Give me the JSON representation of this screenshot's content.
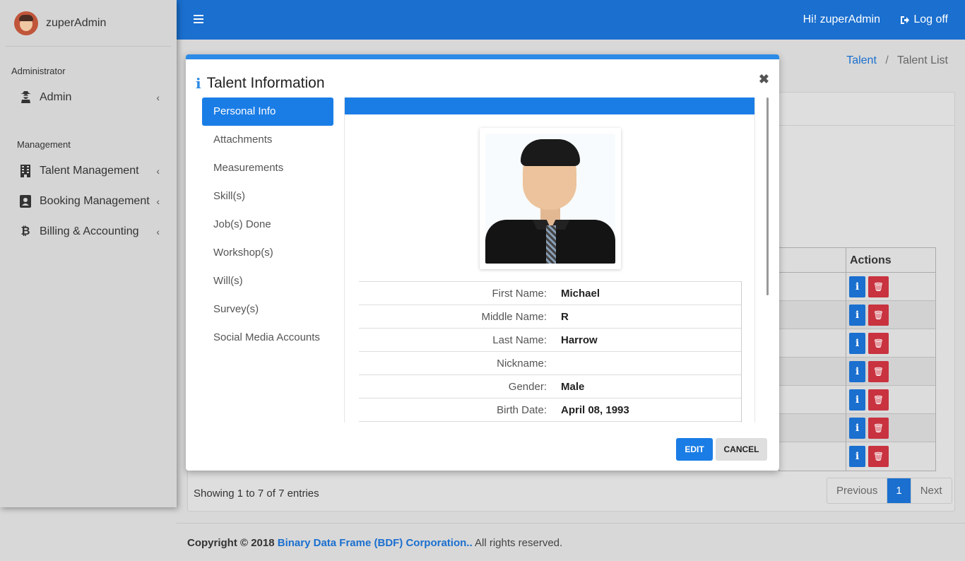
{
  "sidebar": {
    "user_name": "zuperAdmin",
    "section1": "Administrator",
    "admin_item": "Admin",
    "section2": "Management",
    "items": [
      {
        "label": "Talent Management",
        "icon": "building-icon"
      },
      {
        "label": "Booking Management",
        "icon": "contact-book-icon"
      },
      {
        "label": "Billing & Accounting",
        "icon": "bitcoin-icon"
      }
    ]
  },
  "topbar": {
    "greeting": "Hi! zuperAdmin",
    "logoff": "Log off"
  },
  "breadcrumb": {
    "link": "Talent",
    "current": "Talent List"
  },
  "table": {
    "actions_header": "Actions",
    "row_count": 7
  },
  "entries_text": "Showing 1 to 7 of 7 entries",
  "pager": {
    "previous": "Previous",
    "page": "1",
    "next": "Next"
  },
  "footer": {
    "copyright": "Copyright © 2018",
    "company": "Binary Data Frame (BDF) Corporation..",
    "rights": "All rights reserved."
  },
  "modal": {
    "title": "Talent Information",
    "tabs": [
      "Personal Info",
      "Attachments",
      "Measurements",
      "Skill(s)",
      "Job(s) Done",
      "Workshop(s)",
      "Will(s)",
      "Survey(s)",
      "Social Media Accounts"
    ],
    "fields": [
      {
        "label": "First Name:",
        "value": "Michael"
      },
      {
        "label": "Middle Name:",
        "value": "R"
      },
      {
        "label": "Last Name:",
        "value": "Harrow"
      },
      {
        "label": "Nickname:",
        "value": ""
      },
      {
        "label": "Gender:",
        "value": "Male"
      },
      {
        "label": "Birth Date:",
        "value": "April 08, 1993"
      }
    ],
    "edit_label": "EDIT",
    "cancel_label": "CANCEL"
  },
  "colors": {
    "primary": "#1a6fcf",
    "danger": "#c8333f",
    "modal_accent": "#2b8be6"
  }
}
